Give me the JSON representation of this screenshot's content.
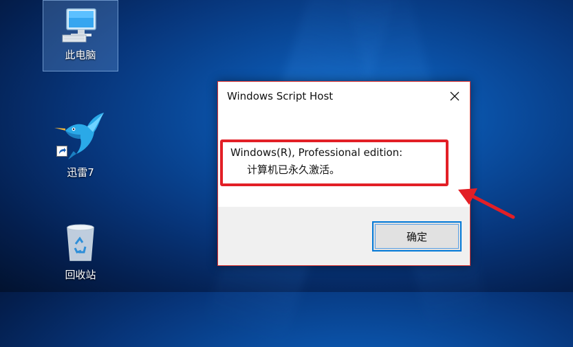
{
  "desktop": {
    "icons": [
      {
        "label": "此电脑",
        "icon": "computer-icon"
      },
      {
        "label": "迅雷7",
        "icon": "bird-icon"
      },
      {
        "label": "回收站",
        "icon": "recycle-bin-icon"
      }
    ]
  },
  "dialog": {
    "title": "Windows Script Host",
    "message_line1": "Windows(R), Professional edition:",
    "message_line2": "计算机已永久激活。",
    "ok_label": "确定",
    "close_icon": "close-icon"
  },
  "annotation": {
    "highlight_color": "#e21f26",
    "arrow_icon": "red-arrow-icon"
  }
}
